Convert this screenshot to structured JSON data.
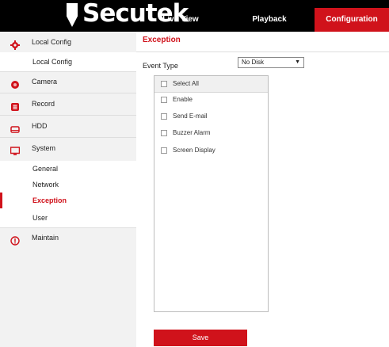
{
  "app": {
    "logo_text": "Secutek"
  },
  "nav": {
    "tabs": [
      {
        "label": "Live View"
      },
      {
        "label": "Playback"
      },
      {
        "label": "Configuration"
      }
    ],
    "active_tab": "Configuration"
  },
  "sidebar": {
    "groups": [
      {
        "label": "Local Config",
        "icon": "gear-icon",
        "subitems": [
          {
            "label": "Local Config"
          }
        ]
      },
      {
        "label": "Camera",
        "icon": "camera-icon"
      },
      {
        "label": "Record",
        "icon": "record-icon"
      },
      {
        "label": "HDD",
        "icon": "hdd-icon"
      },
      {
        "label": "System",
        "icon": "monitor-icon",
        "subitems": [
          {
            "label": "General"
          },
          {
            "label": "Network"
          },
          {
            "label": "Exception"
          },
          {
            "label": "User"
          }
        ]
      },
      {
        "label": "Maintain",
        "icon": "info-icon"
      }
    ],
    "active_item": "Exception"
  },
  "main": {
    "title": "Exception",
    "event_type": {
      "label": "Event Type",
      "value": "No Disk"
    },
    "options": [
      {
        "label": "Select All",
        "checked": false
      },
      {
        "label": "Enable",
        "checked": false
      },
      {
        "label": "Send E-mail",
        "checked": false
      },
      {
        "label": "Buzzer Alarm",
        "checked": false
      },
      {
        "label": "Screen Display",
        "checked": false
      }
    ],
    "save_label": "Save"
  },
  "colors": {
    "accent": "#d0121b",
    "topbar": "#000000",
    "sidebar_bg": "#f2f2f2"
  }
}
